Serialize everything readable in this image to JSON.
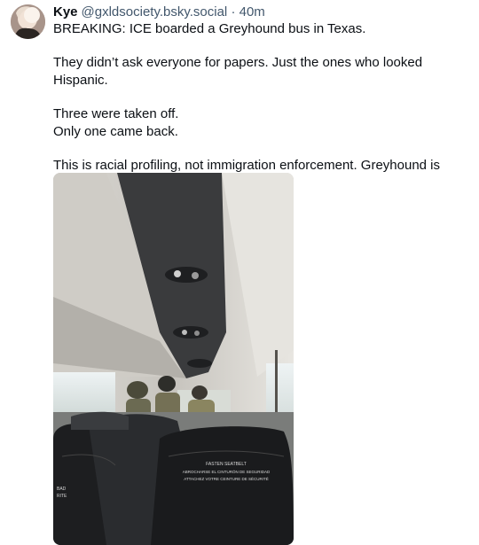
{
  "post": {
    "display_name": "Kye",
    "handle": "@gxldsociety.bsky.social",
    "separator": "·",
    "time": "40m",
    "paragraphs": [
      [
        "BREAKING: ICE boarded a Greyhound bus in Texas."
      ],
      [
        "They didn’t ask everyone for papers. Just the ones who looked Hispanic."
      ],
      [
        "Three were taken off.",
        "Only one came back."
      ],
      [
        "This is racial profiling, not immigration enforcement. Greyhound is complicit—and they fucking know it."
      ]
    ],
    "image": {
      "description_icon": "photo-icon",
      "seat_sign_lines": [
        "FASTEN SEATBELT",
        "ABROCHARSE EL CINTURÓN DE SEGURIDAD",
        "ATTACHEZ VOTRE CEINTURE DE SÉCURITÉ"
      ]
    }
  },
  "colors": {
    "text": "#0b0f14",
    "muted": "#42576c"
  }
}
